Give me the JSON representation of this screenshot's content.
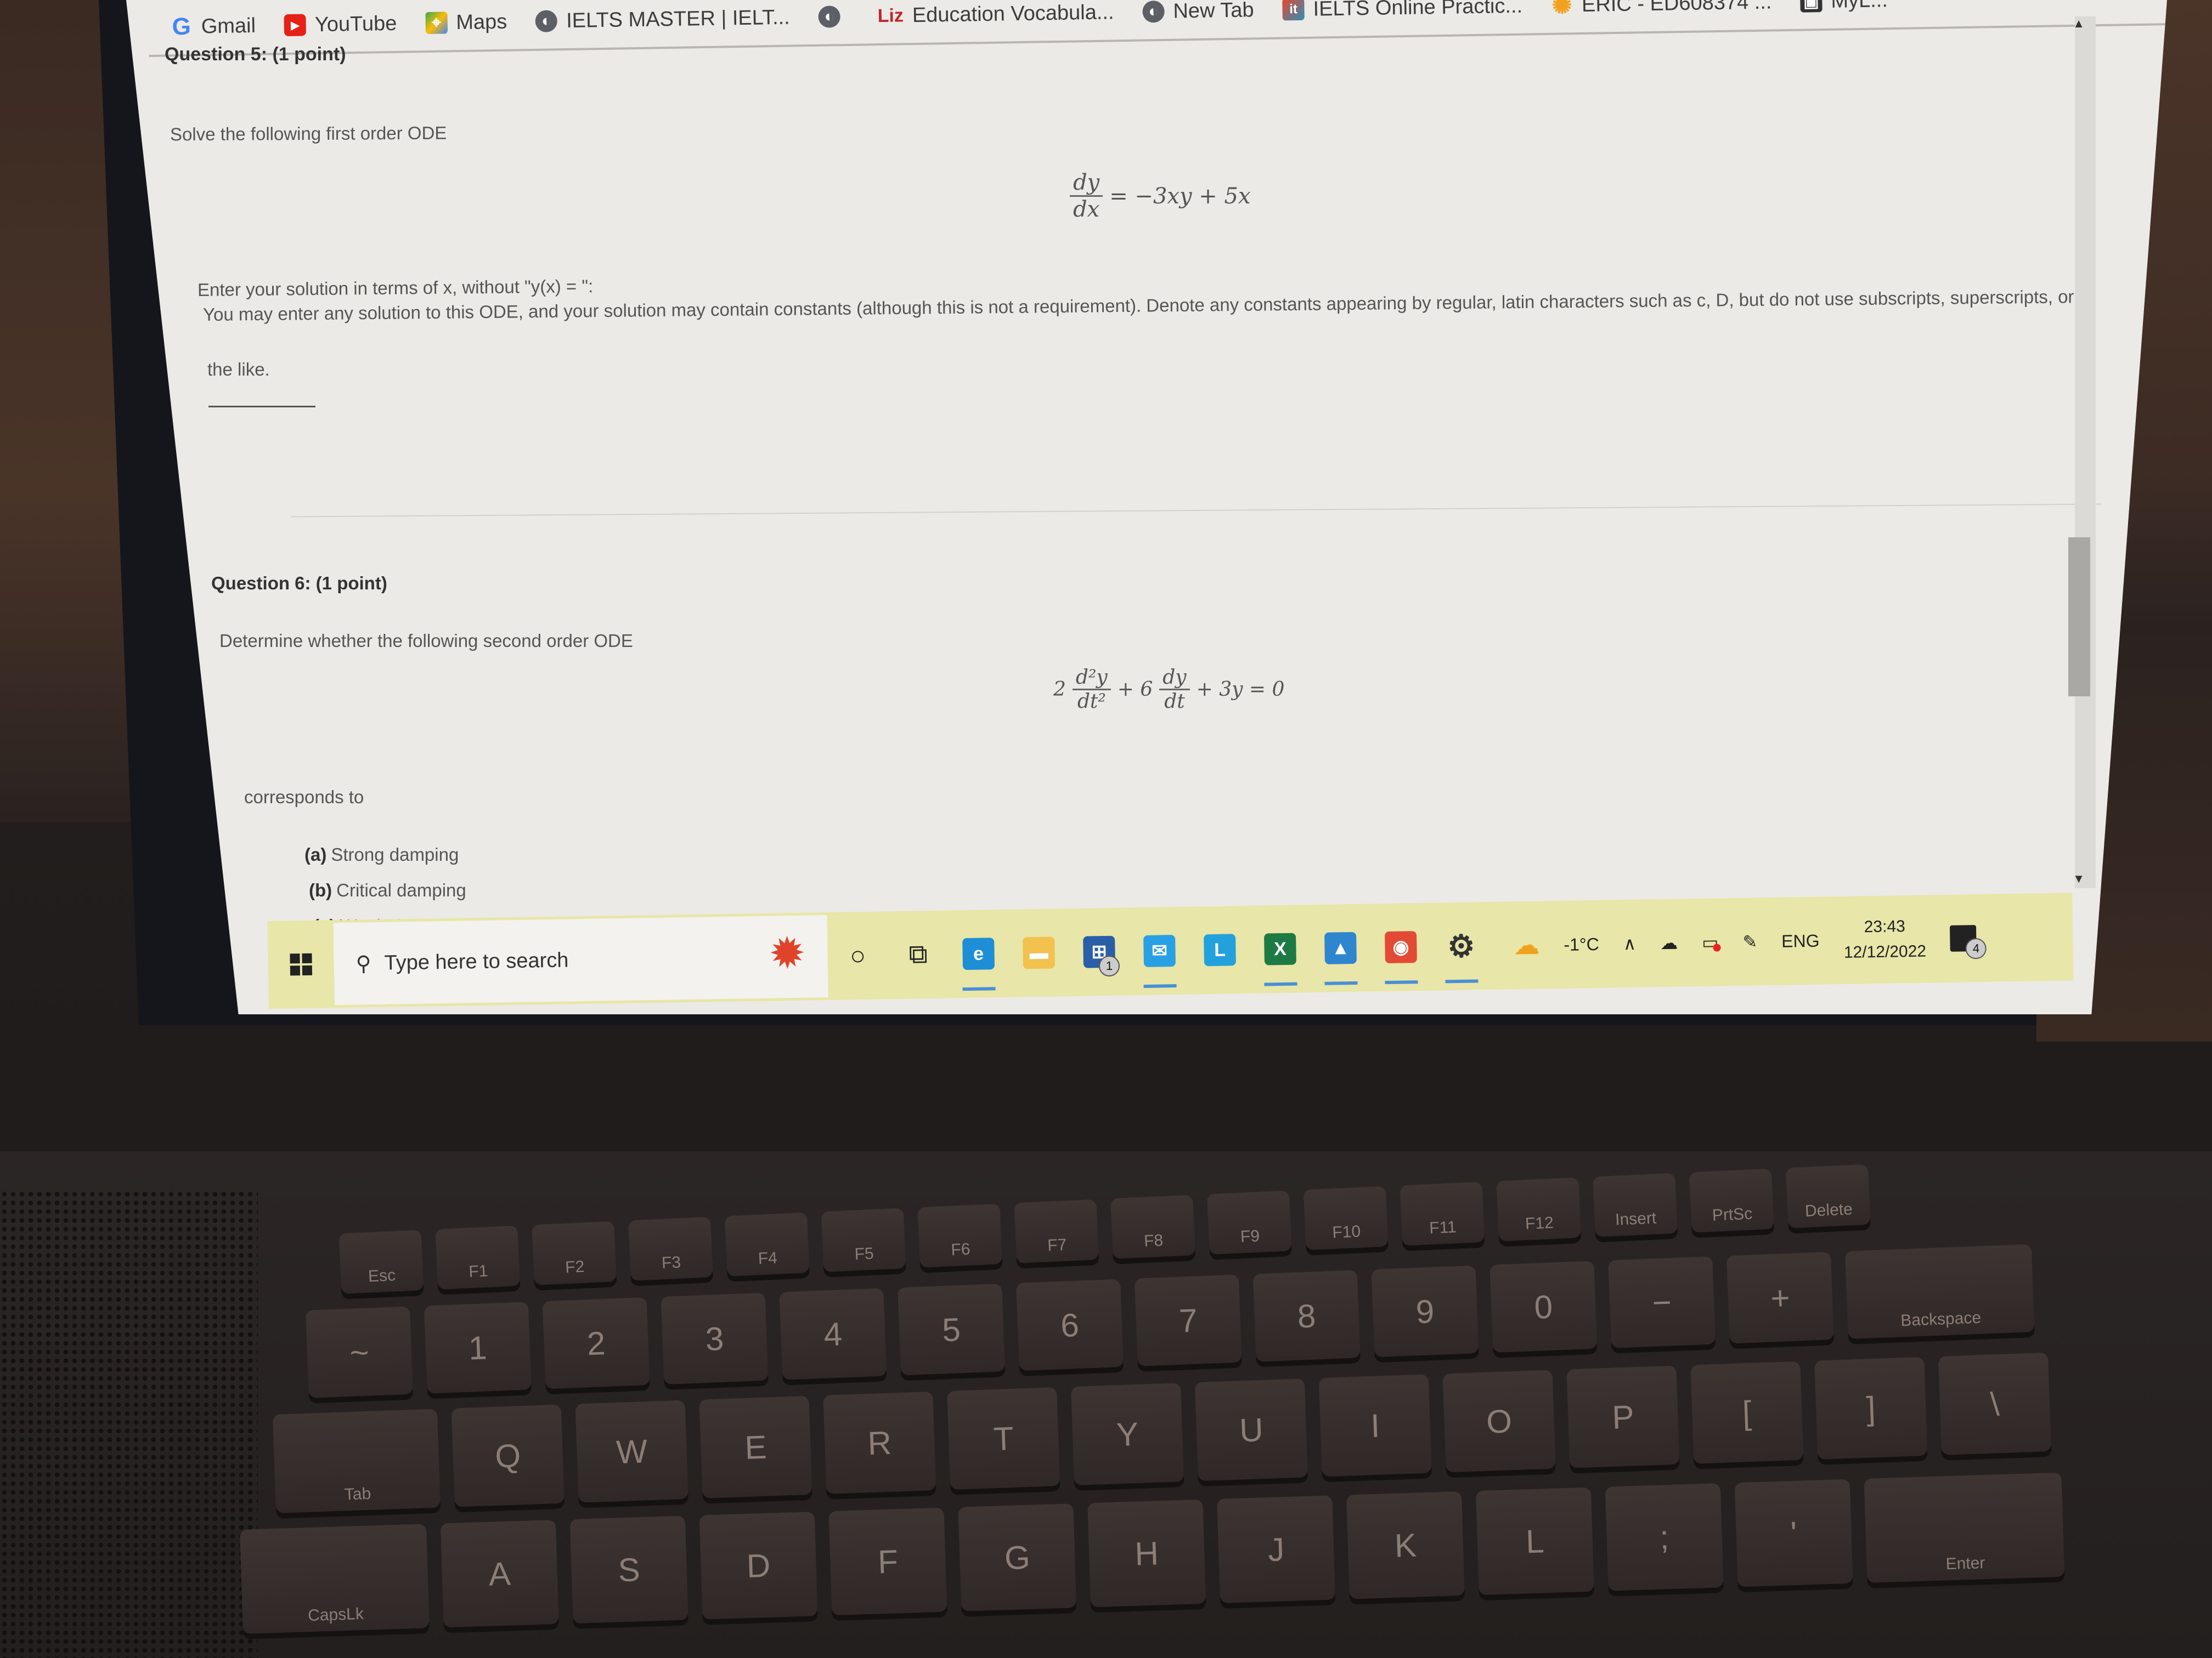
{
  "browser": {
    "bookmarks": [
      {
        "label": "Gmail",
        "icon": "gmail-icon",
        "glyph": "G"
      },
      {
        "label": "YouTube",
        "icon": "youtube-icon",
        "glyph": "▶"
      },
      {
        "label": "Maps",
        "icon": "maps-icon",
        "glyph": "⌖"
      },
      {
        "label": "IELTS MASTER | IELT...",
        "icon": "globe-icon",
        "glyph": "◐"
      },
      {
        "label": "",
        "icon": "globe-icon",
        "glyph": "◐"
      },
      {
        "label": "Education Vocabula...",
        "icon": "liz-icon",
        "glyph": "Liz"
      },
      {
        "label": "New Tab",
        "icon": "globe-icon",
        "glyph": "◐"
      },
      {
        "label": "IELTS Online Practic...",
        "icon": "ielts-icon",
        "glyph": "it"
      },
      {
        "label": "ERIC - ED608374 ...",
        "icon": "eric-icon",
        "glyph": "✺"
      },
      {
        "label": "MyL...",
        "icon": "bookmark-app-icon",
        "glyph": "▣"
      }
    ]
  },
  "question5": {
    "header": "Question 5: (1 point)",
    "prompt": "Solve the following first order ODE",
    "equation": {
      "num": "dy",
      "den": "dx",
      "rhs": "= −3xy + 5x"
    },
    "instruction1": "Enter your solution in terms of x, without \"y(x) = \":",
    "instruction2": "You may enter any solution to this ODE, and your solution may contain constants (although this is not a requirement). Denote any constants appearing by regular, latin characters such as c, D, but do not use subscripts, superscripts, or",
    "instruction3": "the like.",
    "answer_value": ""
  },
  "question6": {
    "header": "Question 6: (1 point)",
    "prompt": "Determine whether the following second order ODE",
    "equation": {
      "coef1": "2",
      "num1": "d²y",
      "den1": "dt²",
      "op1": "+ 6",
      "num2": "dy",
      "den2": "dt",
      "rest": "+ 3y = 0"
    },
    "corresponds": "corresponds to",
    "options": [
      {
        "key": "(a)",
        "label": "Strong damping"
      },
      {
        "key": "(b)",
        "label": "Critical damping"
      },
      {
        "key": "(c)",
        "label": "Weak damping (oscillatory solutions)"
      }
    ]
  },
  "taskbar": {
    "search_placeholder": "Type here to search",
    "apps": [
      {
        "name": "cortana",
        "glyph": "○"
      },
      {
        "name": "task-view",
        "glyph": "⧉"
      },
      {
        "name": "edge",
        "glyph": "e",
        "color": "#1e8fd6",
        "active": true
      },
      {
        "name": "file-explorer",
        "glyph": "▬",
        "color": "#f2c14e"
      },
      {
        "name": "store",
        "glyph": "⊞",
        "color": "#2b5ea8",
        "badge": "1"
      },
      {
        "name": "mail",
        "glyph": "✉",
        "color": "#2aa0e4",
        "active": true
      },
      {
        "name": "l-app",
        "glyph": "L",
        "color": "#23a1dc"
      },
      {
        "name": "excel",
        "glyph": "X",
        "color": "#1d7a45",
        "active": true
      },
      {
        "name": "photos",
        "glyph": "▲",
        "color": "#2e86cf",
        "active": true
      },
      {
        "name": "chrome",
        "glyph": "◉",
        "color": "#e24a36",
        "active": true
      },
      {
        "name": "settings",
        "glyph": "⚙",
        "color": "#333",
        "active": true
      }
    ],
    "weather": "-1°C",
    "language": "ENG",
    "time": "23:43",
    "date": "12/12/2022",
    "notifications": "4"
  },
  "keyboard": {
    "fn_row": [
      "Esc",
      "F1",
      "F2",
      "F3",
      "F4",
      "F5",
      "F6",
      "F7",
      "F8",
      "F9",
      "F10",
      "F11",
      "F12",
      "Insert",
      "PrtSc",
      "Delete"
    ],
    "number_row": [
      "~",
      "1",
      "2",
      "3",
      "4",
      "5",
      "6",
      "7",
      "8",
      "9",
      "0",
      "−",
      "+",
      "Backspace"
    ],
    "top_row": [
      "Tab",
      "Q",
      "W",
      "E",
      "R",
      "T",
      "Y",
      "U",
      "I",
      "O",
      "P",
      "[",
      "]",
      "\\"
    ],
    "home_row": [
      "CapsLk",
      "A",
      "S",
      "D",
      "F",
      "G",
      "H",
      "J",
      "K",
      "L",
      ";",
      "'",
      "Enter"
    ]
  }
}
